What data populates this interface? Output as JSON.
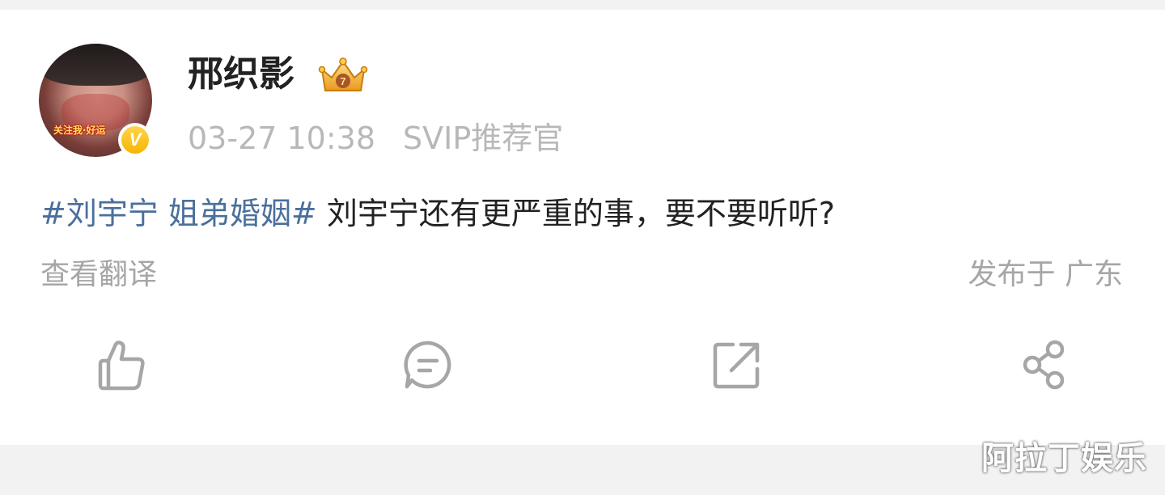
{
  "post": {
    "author": {
      "name": "邢织影",
      "avatar_caption": "关注我·好运"
    },
    "time": "03-27 10:38",
    "source": "SVIP推荐官",
    "content": {
      "hashtag": "#刘宇宁 姐弟婚姻#",
      "text": "刘宇宁还有更严重的事，要不要听听?"
    },
    "translate_label": "查看翻译",
    "location": "发布于 广东"
  },
  "actions": {
    "like_icon": "thumbs-up-icon",
    "comment_icon": "comment-icon",
    "repost_icon": "repost-icon",
    "share_icon": "share-icon"
  },
  "watermark": "阿拉丁娱乐",
  "colors": {
    "tag": "#4a6f9c",
    "meta": "#b8b8b8",
    "icon": "#a6a6a6"
  }
}
